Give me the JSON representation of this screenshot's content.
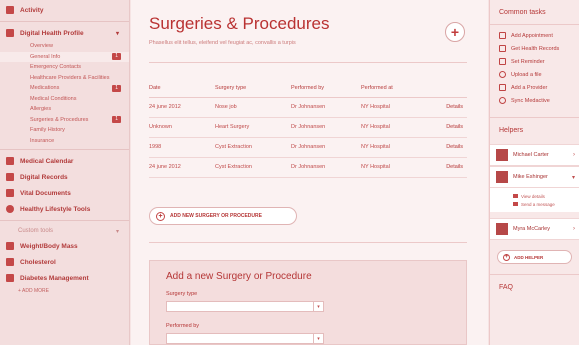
{
  "sidebar": {
    "activity": "Activity",
    "profile": {
      "label": "Digital Health Profile",
      "items": [
        {
          "label": "Overview",
          "badge": ""
        },
        {
          "label": "General Info",
          "badge": "1"
        },
        {
          "label": "Emergency Contacts",
          "badge": ""
        },
        {
          "label": "Healthcare Providers & Facilities",
          "badge": ""
        },
        {
          "label": "Medications",
          "badge": "1"
        },
        {
          "label": "Medical Conditions",
          "badge": ""
        },
        {
          "label": "Allergies",
          "badge": ""
        },
        {
          "label": "Surgeries & Procedures",
          "badge": "1"
        },
        {
          "label": "Family History",
          "badge": ""
        },
        {
          "label": "Insurance",
          "badge": ""
        }
      ]
    },
    "nav": [
      {
        "label": "Medical Calendar"
      },
      {
        "label": "Digital Records"
      },
      {
        "label": "Vital Documents"
      },
      {
        "label": "Healthy Lifestyle Tools"
      }
    ],
    "custom_tools": {
      "label": "Custom tools",
      "items": [
        {
          "label": "Weight/Body Mass"
        },
        {
          "label": "Cholesterol"
        },
        {
          "label": "Diabetes Management"
        }
      ],
      "more": "+ ADD MORE"
    }
  },
  "main": {
    "title": "Surgeries & Procedures",
    "subtitle": "Phasellus elit tellus, eleifend vel feugiat ac, convallis a turpis",
    "table": {
      "headers": [
        "Date",
        "Surgery type",
        "Performed by",
        "Performed at",
        ""
      ],
      "rows": [
        [
          "24 june 2012",
          "Nose job",
          "Dr Johnansen",
          "NY Hospital",
          "Details"
        ],
        [
          "Unknown",
          "Heart Surgery",
          "Dr Johnansen",
          "NY Hospital",
          "Details"
        ],
        [
          "1998",
          "Cyst Extraction",
          "Dr Johnansen",
          "NY Hospital",
          "Details"
        ],
        [
          "24 june 2012",
          "Cyst Extraction",
          "Dr Johnansen",
          "NY Hospital",
          "Details"
        ]
      ]
    },
    "add_button": "ADD NEW SURGERY OR PROCEDURE",
    "form": {
      "title": "Add a new Surgery or Procedure",
      "surgery_type_label": "Surgery type",
      "performed_by_label": "Performed by"
    }
  },
  "right": {
    "common_tasks_title": "Common tasks",
    "tasks": [
      {
        "label": "Add Appointment"
      },
      {
        "label": "Get Health Records"
      },
      {
        "label": "Set Reminder"
      },
      {
        "label": "Upload a file"
      },
      {
        "label": "Add a Provider"
      },
      {
        "label": "Sync Medactive"
      }
    ],
    "helpers_title": "Helpers",
    "helpers": [
      {
        "name": "Michael Carter"
      },
      {
        "name": "Mike Eshinger",
        "view": "View details",
        "send": "Send a message"
      },
      {
        "name": "Myra McCarley"
      }
    ],
    "add_helper": "ADD HELPER",
    "faq_title": "FAQ"
  },
  "colors": {
    "accent": "#b93232",
    "background": "#f6e4e4"
  }
}
